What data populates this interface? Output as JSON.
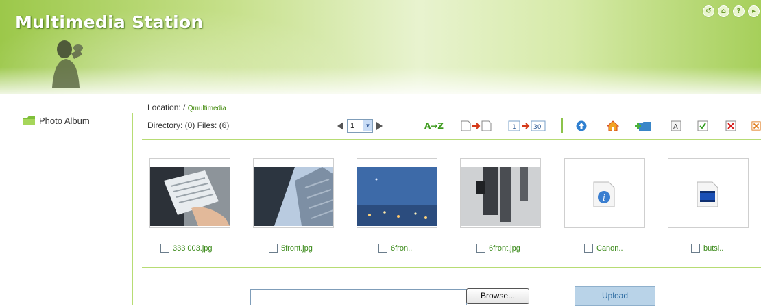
{
  "header": {
    "title": "Multimedia Station",
    "icons": [
      "back-icon",
      "home-icon",
      "help-icon",
      "logout-icon"
    ]
  },
  "sidebar": {
    "items": [
      {
        "label": "Photo Album",
        "icon": "folder-icon"
      }
    ]
  },
  "location": {
    "label": "Location: /",
    "path": "Qmultimedia"
  },
  "directory": {
    "text": "Directory: (0) Files: (6)"
  },
  "pager": {
    "current_page": "1"
  },
  "toolbar": {
    "sort_label": "A→Z",
    "tools": [
      "sort-az-icon",
      "move-file-icon",
      "page-range-icon",
      "upload-circle-icon",
      "home-icon",
      "add-folder-icon",
      "rename-icon",
      "select-all-icon",
      "delete-icon",
      "close-icon"
    ]
  },
  "files": [
    {
      "name": "333 003.jpg",
      "type": "image"
    },
    {
      "name": "5front.jpg",
      "type": "image"
    },
    {
      "name": "6fron..",
      "type": "image"
    },
    {
      "name": "6front.jpg",
      "type": "image"
    },
    {
      "name": "Canon..",
      "type": "info-file"
    },
    {
      "name": "butsi..",
      "type": "video-file"
    }
  ],
  "upload": {
    "file_value": "",
    "browse_label": "Browse...",
    "upload_label": "Upload"
  },
  "colors": {
    "accent_green": "#8cc34b",
    "link_green": "#3b8a1a",
    "upload_bg": "#b9d3e8"
  }
}
